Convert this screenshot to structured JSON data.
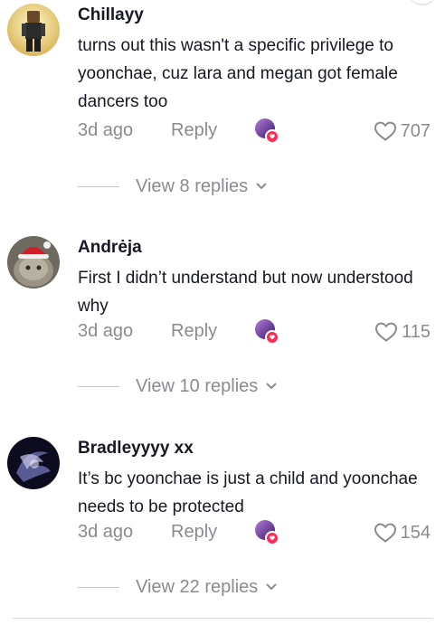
{
  "comments": [
    {
      "username": "Chillayy",
      "text": "turns out this wasn't a specific privilege to yoonchae, cuz lara and megan got female dancers too",
      "time": "3d ago",
      "reply_label": "Reply",
      "likes": "707",
      "view_replies": "View 8 replies"
    },
    {
      "username": "Andrėja",
      "text": "First I didn’t understand but now understood why",
      "time": "3d ago",
      "reply_label": "Reply",
      "likes": "115",
      "view_replies": "View 10 replies"
    },
    {
      "username": "Bradleyyyy xx",
      "text": "It’s bc yoonchae is just a child and yoonchae needs to be protected",
      "time": "3d ago",
      "reply_label": "Reply",
      "likes": "154",
      "view_replies": "View 22 replies"
    }
  ],
  "colors": {
    "text": "#161823",
    "muted": "#8a8b91",
    "creator_badge": "#fe2c55"
  },
  "icons": [
    "heart-icon",
    "chevron-down-icon",
    "creator-liked-icon"
  ]
}
